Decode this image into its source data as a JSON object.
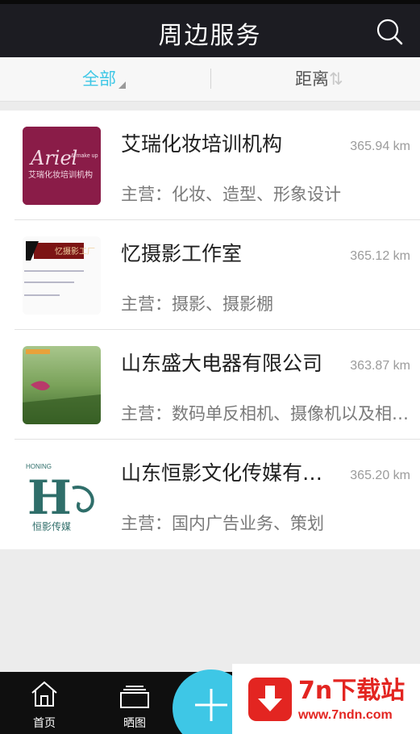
{
  "header": {
    "title": "周边服务",
    "search_icon": "search-icon"
  },
  "filters": {
    "all_label": "全部",
    "distance_label": "距离",
    "distance_tail": "⇅"
  },
  "businesses": [
    {
      "name": "艾瑞化妆培训机构",
      "distance": "365.94 km",
      "business": "主营：化妆、造型、形象设计",
      "thumb": {
        "script": "Ariel",
        "sub": "& make up",
        "cn": "艾瑞化妆培训机构"
      }
    },
    {
      "name": "忆摄影工作室",
      "distance": "365.12 km",
      "business": "主营：摄影、摄影棚",
      "thumb": {
        "cn": "忆摄影工厂"
      }
    },
    {
      "name": "山东盛大电器有限公司",
      "distance": "363.87 km",
      "business": "主营：数码单反相机、摄像机以及相关配件"
    },
    {
      "name": "山东恒影文化传媒有限公司",
      "distance": "365.20 km",
      "business": "主营：国内广告业务、策划",
      "thumb": {
        "en": "HONING",
        "letter": "H",
        "cn": "恒影传媒"
      }
    }
  ],
  "bottom_nav": {
    "home_label": "首页",
    "photo_label": "晒图"
  },
  "watermark": {
    "brand": "7n下载站",
    "url": "www.7ndn.com"
  },
  "colors": {
    "accent": "#3ec7e6",
    "header": "#1c1c22",
    "bottom_bar": "#0f0f0f",
    "watermark": "#e32521"
  }
}
